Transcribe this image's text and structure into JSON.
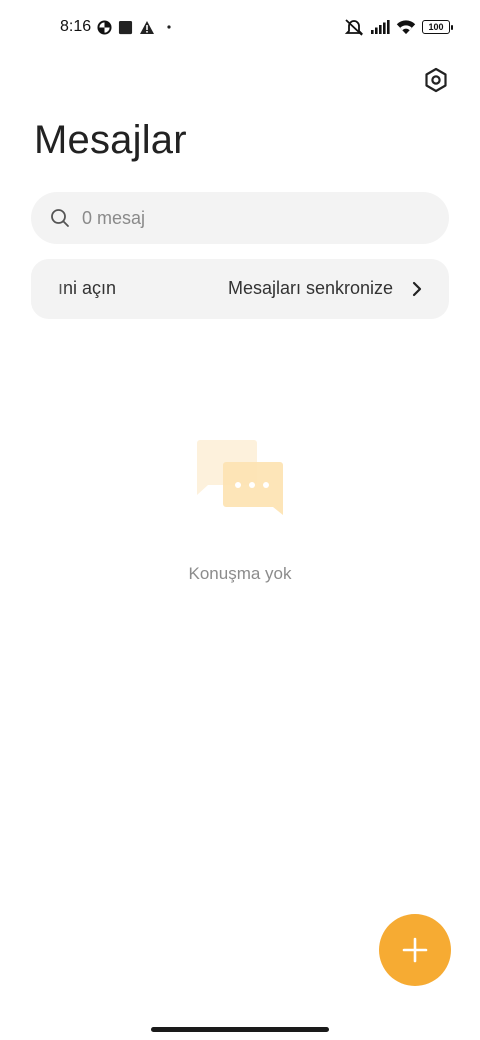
{
  "status_bar": {
    "time": "8:16",
    "battery": "100",
    "icons": [
      "data-saver-icon",
      "stop-square-icon",
      "warning-icon",
      "dot-icon",
      "mute-vibrate-icon",
      "signal-icon",
      "wifi-icon",
      "battery-icon"
    ]
  },
  "header": {
    "title": "Mesajlar",
    "settings_icon": "settings-hexagon-icon"
  },
  "search": {
    "placeholder": "0 mesaj",
    "value": "",
    "icon": "search-icon"
  },
  "sync_banner": {
    "left_text": "ıni açın",
    "right_text": "Mesajları senkronize",
    "icon": "chevron-right-icon"
  },
  "empty_state": {
    "icon": "chat-bubbles-icon",
    "text": "Konuşma yok"
  },
  "fab": {
    "icon": "plus-icon"
  },
  "colors": {
    "accent": "#f6ab33",
    "surface": "#f3f3f3",
    "illustration_back": "#fdf1dc",
    "illustration_front": "#fde3b2"
  }
}
